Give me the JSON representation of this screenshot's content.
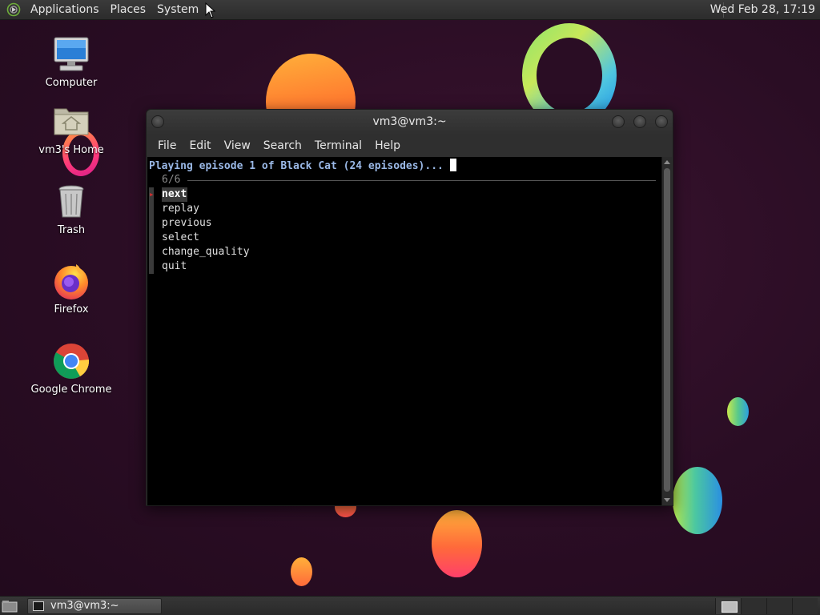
{
  "top_panel": {
    "menus": [
      "Applications",
      "Places",
      "System"
    ],
    "clock": "Wed Feb 28, 17:19"
  },
  "desktop": {
    "icons": [
      {
        "label": "Computer",
        "icon": "computer-icon"
      },
      {
        "label": "vm3's Home",
        "icon": "home-folder-icon"
      },
      {
        "label": "Trash",
        "icon": "trash-icon"
      },
      {
        "label": "Firefox",
        "icon": "firefox-icon"
      },
      {
        "label": "Google Chrome",
        "icon": "chrome-icon"
      }
    ]
  },
  "terminal": {
    "title": "vm3@vm3:~",
    "menus": [
      "File",
      "Edit",
      "View",
      "Search",
      "Terminal",
      "Help"
    ],
    "status_line": "Playing episode 1 of Black Cat (24 episodes)...",
    "counter": "6/6",
    "options": [
      "next",
      "replay",
      "previous",
      "select",
      "change_quality",
      "quit"
    ],
    "selected_option": "next"
  },
  "taskbar": {
    "window_button": "vm3@vm3:~",
    "workspaces": 4
  },
  "colors": {
    "status_text": "#9ab8e6",
    "terminal_bg": "#000000",
    "panel_bg": "#2c2c2c"
  }
}
